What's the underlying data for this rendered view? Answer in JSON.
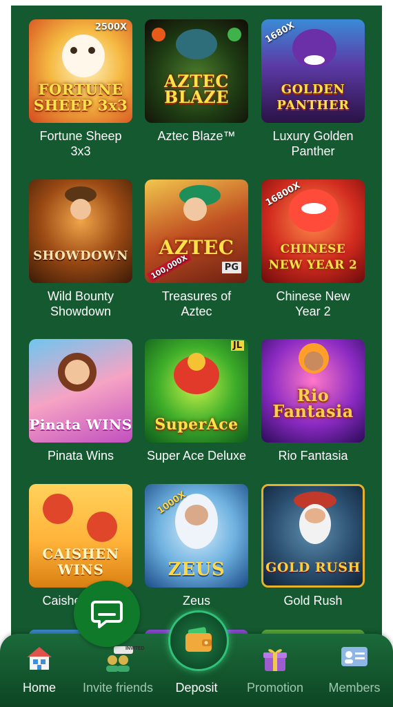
{
  "games": [
    {
      "name": "Fortune Sheep\n3x3",
      "thumb_title": "FORTUNE SHEEP 3x3",
      "badge": "2500X"
    },
    {
      "name": "Aztec Blaze™",
      "thumb_title": "AZTEC BLAZE",
      "badge": ""
    },
    {
      "name": "Luxury Golden\nPanther",
      "thumb_title": "GOLDEN PANTHER",
      "badge": "1680X"
    },
    {
      "name": "Wild Bounty\nShowdown",
      "thumb_title": "SHOWDOWN",
      "badge": ""
    },
    {
      "name": "Treasures of\nAztec",
      "thumb_title": "AZTEC",
      "badge": "100,000X"
    },
    {
      "name": "Chinese New\nYear 2",
      "thumb_title": "CHINESE NEW YEAR 2",
      "badge": "16800X"
    },
    {
      "name": "Pinata Wins",
      "thumb_title": "Pinata WINS",
      "badge": ""
    },
    {
      "name": "Super Ace Deluxe",
      "thumb_title": "SuperAce",
      "badge": "JL"
    },
    {
      "name": "Rio Fantasia",
      "thumb_title": "Rio Fantasia",
      "badge": ""
    },
    {
      "name": "Caishen Wins",
      "thumb_title": "CAISHEN WINS",
      "badge": ""
    },
    {
      "name": "Zeus",
      "thumb_title": "ZEUS",
      "badge": "1000X"
    },
    {
      "name": "Gold Rush",
      "thumb_title": "GOLD RUSH",
      "badge": ""
    }
  ],
  "nav": {
    "home": "Home",
    "invite": "Invite friends",
    "invite_badge": "INVITED",
    "deposit": "Deposit",
    "promotion": "Promotion",
    "members": "Members"
  },
  "icons": {
    "home": "house-icon",
    "invite": "users-icon",
    "deposit": "wallet-icon",
    "promotion": "gift-icon",
    "members": "id-card-icon",
    "chat": "chat-bubble-icon"
  },
  "colors": {
    "panel": "#14592f",
    "nav_active": "#ffffff",
    "nav_inactive": "#9fc7ad"
  }
}
